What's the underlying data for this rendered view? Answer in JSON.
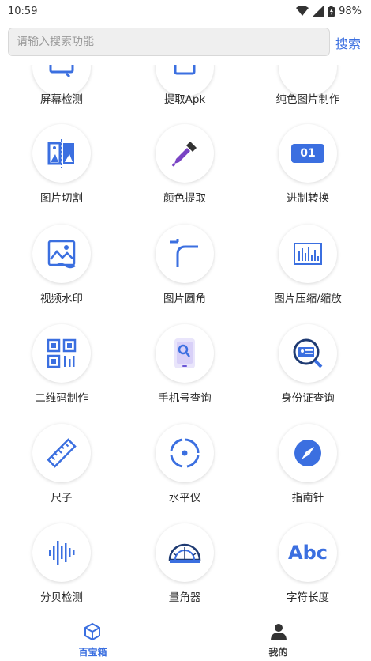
{
  "status_bar": {
    "time": "10:59",
    "battery": "98%"
  },
  "search": {
    "placeholder": "请输入搜索功能",
    "button": "搜索"
  },
  "tools": [
    {
      "label": "屏幕检测",
      "icon": "screen-test-icon"
    },
    {
      "label": "提取Apk",
      "icon": "extract-apk-icon"
    },
    {
      "label": "纯色图片制作",
      "icon": "solid-color-image-icon"
    },
    {
      "label": "图片切割",
      "icon": "image-split-icon"
    },
    {
      "label": "颜色提取",
      "icon": "eyedropper-icon"
    },
    {
      "label": "进制转换",
      "icon": "base-convert-icon",
      "icon_text": "01"
    },
    {
      "label": "视频水印",
      "icon": "video-watermark-icon"
    },
    {
      "label": "图片圆角",
      "icon": "rounded-corner-icon"
    },
    {
      "label": "图片压缩/缩放",
      "icon": "image-compress-icon"
    },
    {
      "label": "二维码制作",
      "icon": "qr-code-icon"
    },
    {
      "label": "手机号查询",
      "icon": "phone-search-icon"
    },
    {
      "label": "身份证查询",
      "icon": "id-card-search-icon"
    },
    {
      "label": "尺子",
      "icon": "ruler-icon"
    },
    {
      "label": "水平仪",
      "icon": "level-icon"
    },
    {
      "label": "指南针",
      "icon": "compass-icon"
    },
    {
      "label": "分贝检测",
      "icon": "decibel-icon"
    },
    {
      "label": "量角器",
      "icon": "protractor-icon"
    },
    {
      "label": "字符长度",
      "icon": "text-length-icon",
      "icon_text": "Abc"
    }
  ],
  "nav": {
    "toolbox": {
      "label": "百宝箱",
      "active_color": "#3b6fe0"
    },
    "mine": {
      "label": "我的",
      "color": "#333333"
    }
  },
  "colors": {
    "accent": "#3b6fe0"
  }
}
